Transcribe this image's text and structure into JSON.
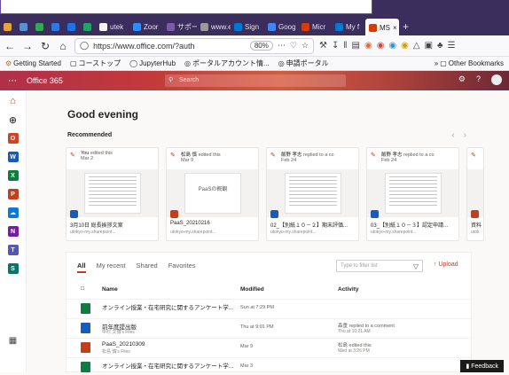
{
  "browser": {
    "tabs": [
      {
        "label": "",
        "color": "#e8a33a"
      },
      {
        "label": "",
        "color": "#5a8fd8"
      },
      {
        "label": "",
        "color": "#34a853"
      },
      {
        "label": "",
        "color": "#2a7ae2"
      },
      {
        "label": "",
        "color": "#1a73e8"
      },
      {
        "label": "",
        "color": "#21a366"
      },
      {
        "label": "utek",
        "color": "#f5f5f5"
      },
      {
        "label": "Zoor",
        "color": "#2d8cff"
      },
      {
        "label": "サポー",
        "color": "#7b5aa8"
      },
      {
        "label": "www.ec",
        "color": "#999999"
      },
      {
        "label": "Sign",
        "color": "#0078d4"
      },
      {
        "label": "Goog",
        "color": "#4285f4"
      },
      {
        "label": "Micr",
        "color": "#d83b01"
      },
      {
        "label": "My f",
        "color": "#0078d4"
      },
      {
        "label": "MS",
        "color": "#d83b01",
        "active": true
      }
    ],
    "new_tab": "+",
    "url": "https://www.office.com/?auth",
    "zoom": "80%",
    "bookmarks": [
      "Getting Started",
      "コーストップ",
      "JupyterHub",
      "ポータルアカウント情...",
      "申請ポータル"
    ],
    "other_bookmarks": "Other Bookmarks"
  },
  "o365": {
    "title": "Office 365",
    "search_placeholder": "Search",
    "greeting": "Good evening",
    "recommended": "Recommended"
  },
  "cards": [
    {
      "who": "You",
      "action": "edited this",
      "date": "Mar 2",
      "name": "3月10日 総長挨拶文案",
      "loc": "utokyo-my.sharepoint...",
      "app_color": "#185abd",
      "kind": "text"
    },
    {
      "who": "松島 慎",
      "action": "edited this",
      "date": "Mar 9",
      "name": "PaaS_20210216",
      "loc": "utokyo-my.sharepoint...",
      "app_color": "#c43e1c",
      "kind": "slide",
      "slide_text": "PaaSの概観"
    },
    {
      "who": "飯野 孝志",
      "action": "replied to a co",
      "date": "Feb 24",
      "name": "02_【別紙１０－２】期末評価...",
      "loc": "utokyo-my.sharepoint...",
      "app_color": "#185abd",
      "kind": "text"
    },
    {
      "who": "飯野 孝志",
      "action": "replied to a co",
      "date": "Feb 24",
      "name": "03_【別紙１０－３】認定申請...",
      "loc": "utokyo-my.sharepoint...",
      "app_color": "#185abd",
      "kind": "form"
    },
    {
      "who": "",
      "action": "",
      "date": "",
      "name": "資料",
      "loc": "utok",
      "app_color": "#c43e1c",
      "kind": "text"
    }
  ],
  "files": {
    "tabs": [
      "All",
      "My recent",
      "Shared",
      "Favorites"
    ],
    "filter_placeholder": "Type to filter list",
    "upload": "Upload",
    "col_name": "Name",
    "col_modified": "Modified",
    "col_activity": "Activity",
    "rows": [
      {
        "name": "オンライン授業・在宅研究に関するアンケート学...",
        "sub": "",
        "modified": "Sun at 7:29 PM",
        "activity": "",
        "activity2": "",
        "color": "#107c41"
      },
      {
        "name": "前年度提出版",
        "sub": "中村 文博's Files",
        "modified": "Thu at 9:01 PM",
        "activity": "森重 replied to a comment",
        "activity2": "Thu at 10:21 AM",
        "color": "#185abd"
      },
      {
        "name": "PaaS_20210309",
        "sub": "松島 慎's Files",
        "modified": "Mar 9",
        "activity": "松島 edited this",
        "activity2": "Wed at 3:26 PM",
        "color": "#c43e1c"
      },
      {
        "name": "オンライン授業・在宅研究に関するアンケート学...",
        "sub": "",
        "modified": "Mar 3",
        "activity": "",
        "activity2": "",
        "color": "#107c41"
      }
    ]
  },
  "feedback": "Feedback"
}
